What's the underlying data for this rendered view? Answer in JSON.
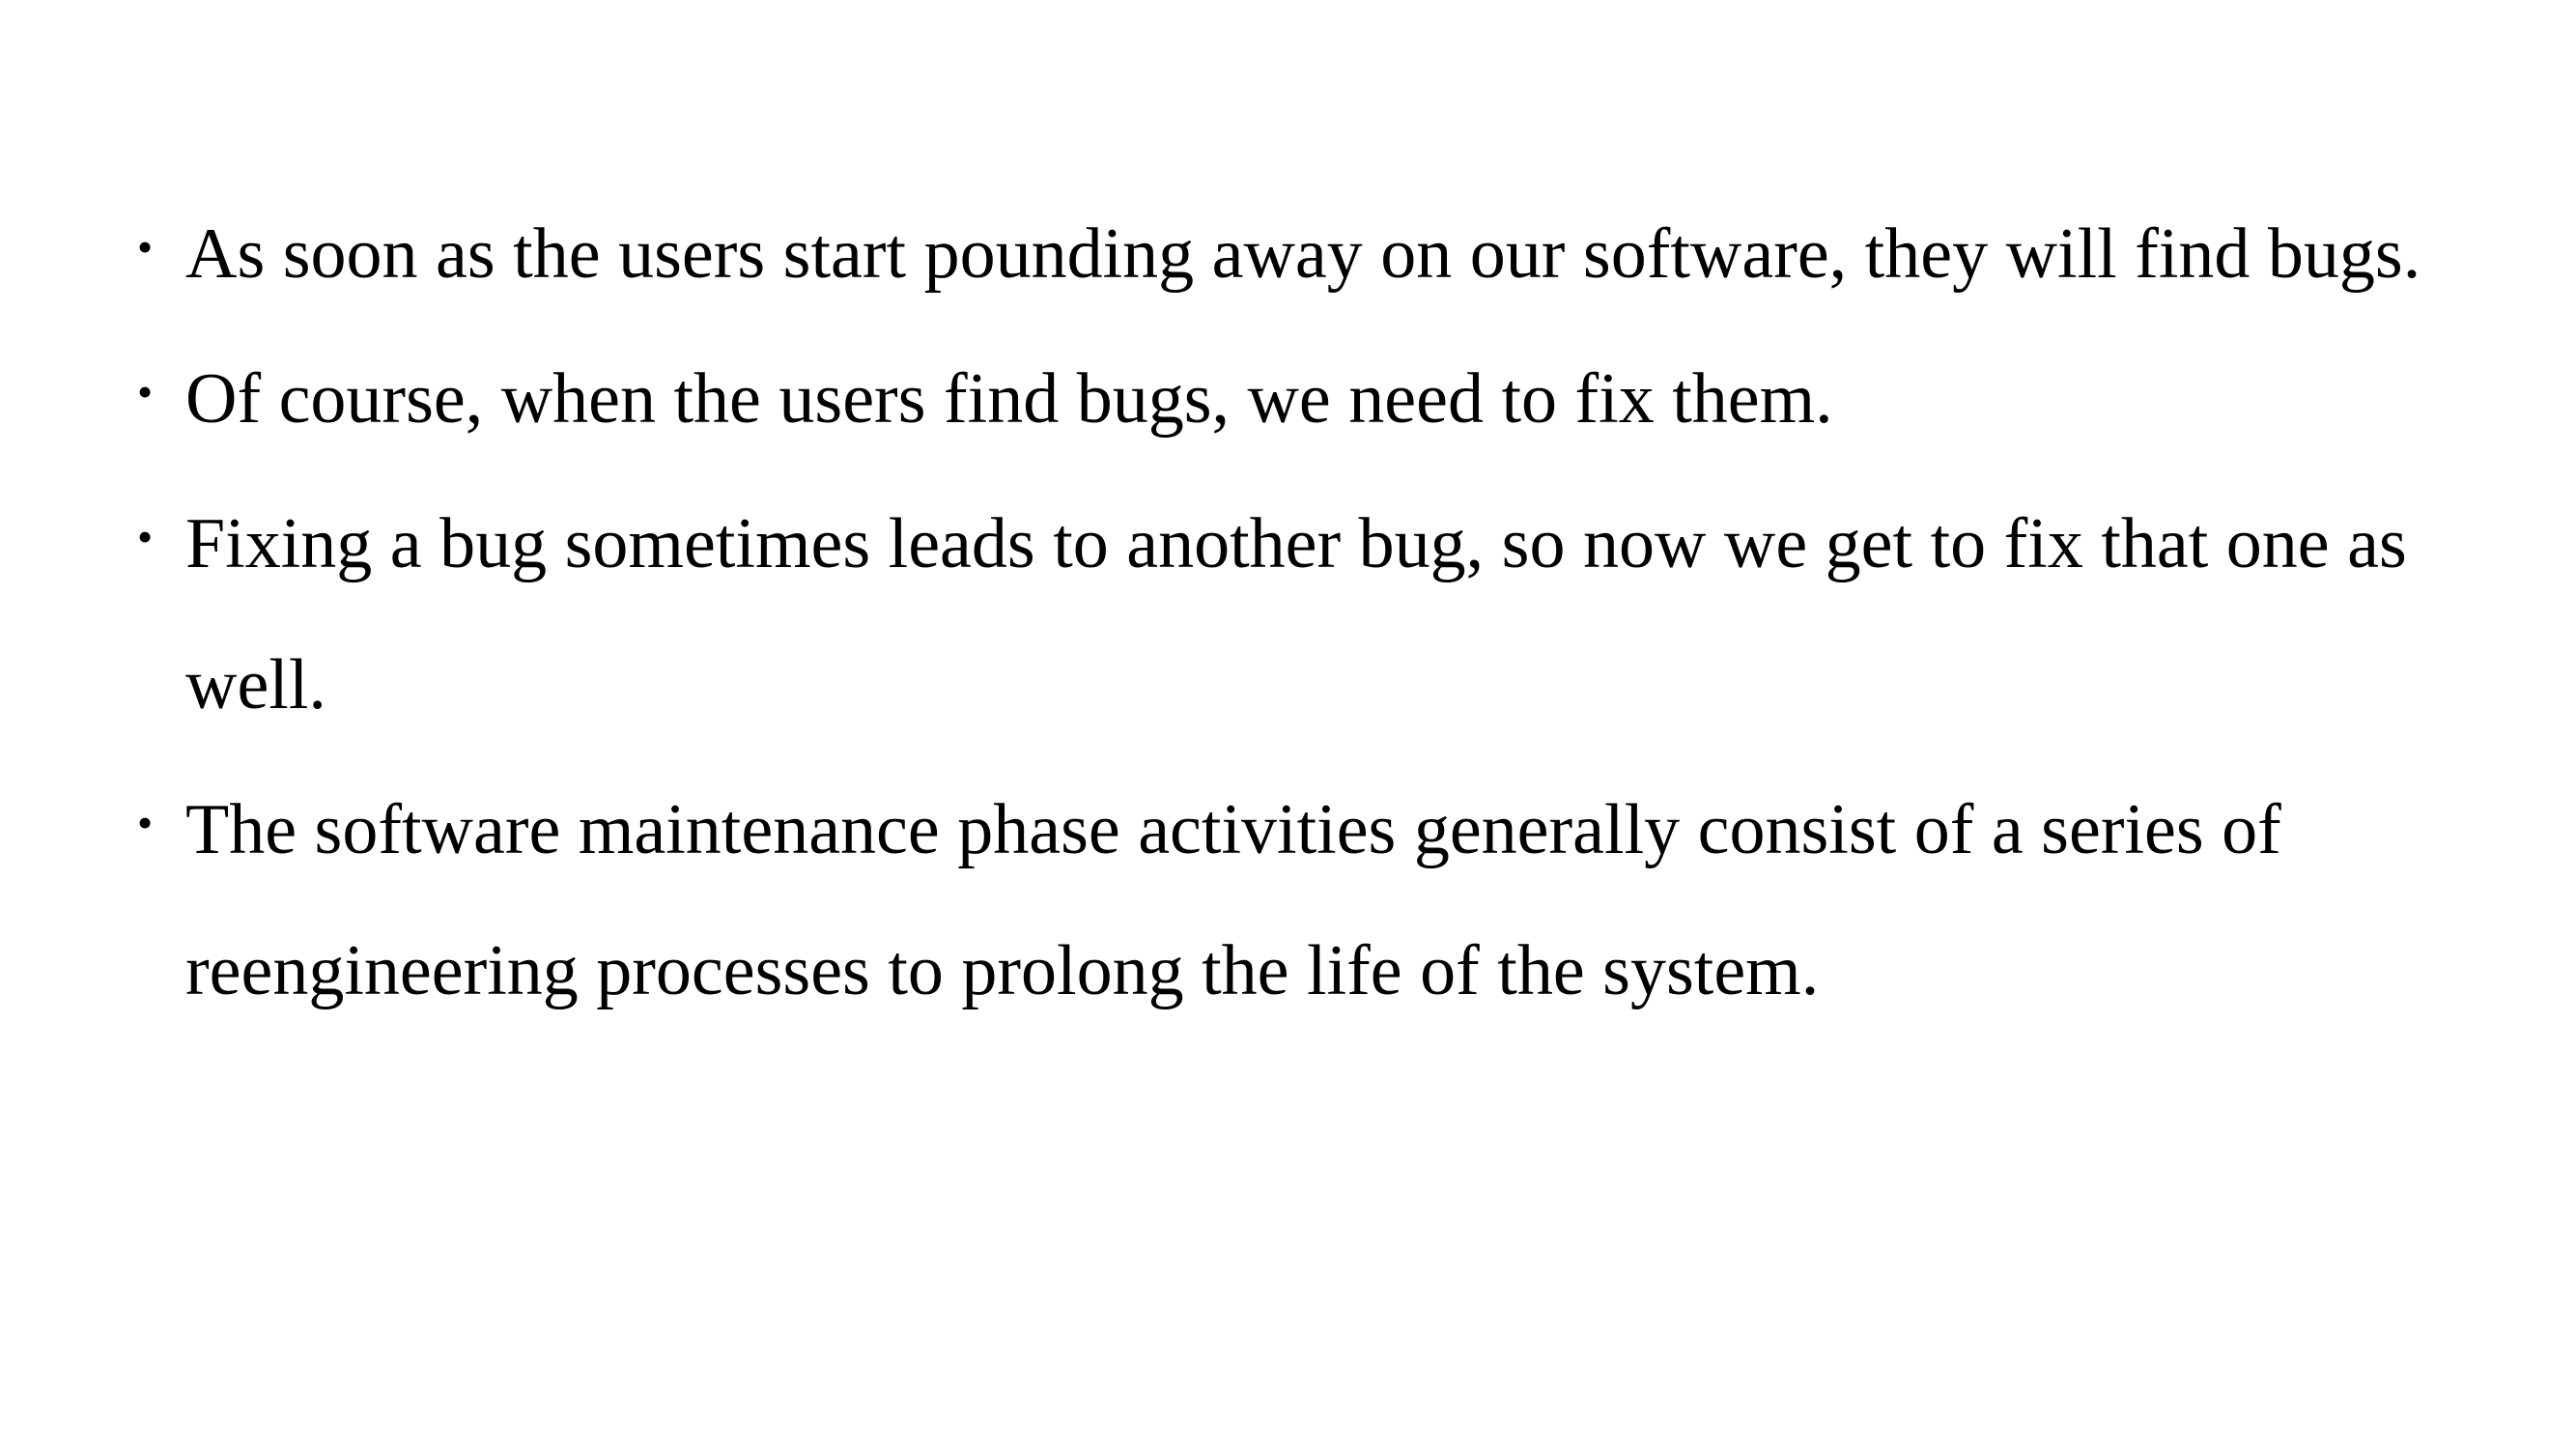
{
  "slide": {
    "bullets": [
      {
        "marker": "•",
        "text": "As soon as the users start pounding away on our software, they will find bugs."
      },
      {
        "marker": "•",
        "text": "Of course, when the users find bugs, we need to fix them."
      },
      {
        "marker": "•",
        "text": "Fixing a bug sometimes leads to another bug, so now we get to fix that one as well."
      },
      {
        "marker": "•",
        "text": "The software maintenance phase activities generally consist of a series of reengineering processes to prolong the life of the system."
      }
    ]
  }
}
